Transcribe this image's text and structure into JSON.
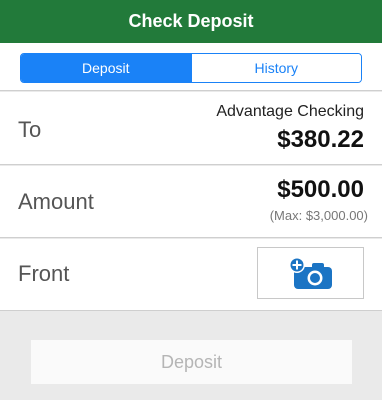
{
  "header": {
    "title": "Check Deposit"
  },
  "tabs": [
    {
      "label": "Deposit",
      "active": true
    },
    {
      "label": "History",
      "active": false
    }
  ],
  "to": {
    "label": "To",
    "account": "Advantage Checking",
    "balance": "$380.22"
  },
  "amount": {
    "label": "Amount",
    "value": "$500.00",
    "max": "(Max: $3,000.00)"
  },
  "front": {
    "label": "Front",
    "icon": "add-camera-icon"
  },
  "deposit_button": {
    "label": "Deposit",
    "enabled": false
  },
  "colors": {
    "header_bg": "#227a3a",
    "accent": "#1a82f7",
    "camera_icon": "#1b74c4"
  }
}
